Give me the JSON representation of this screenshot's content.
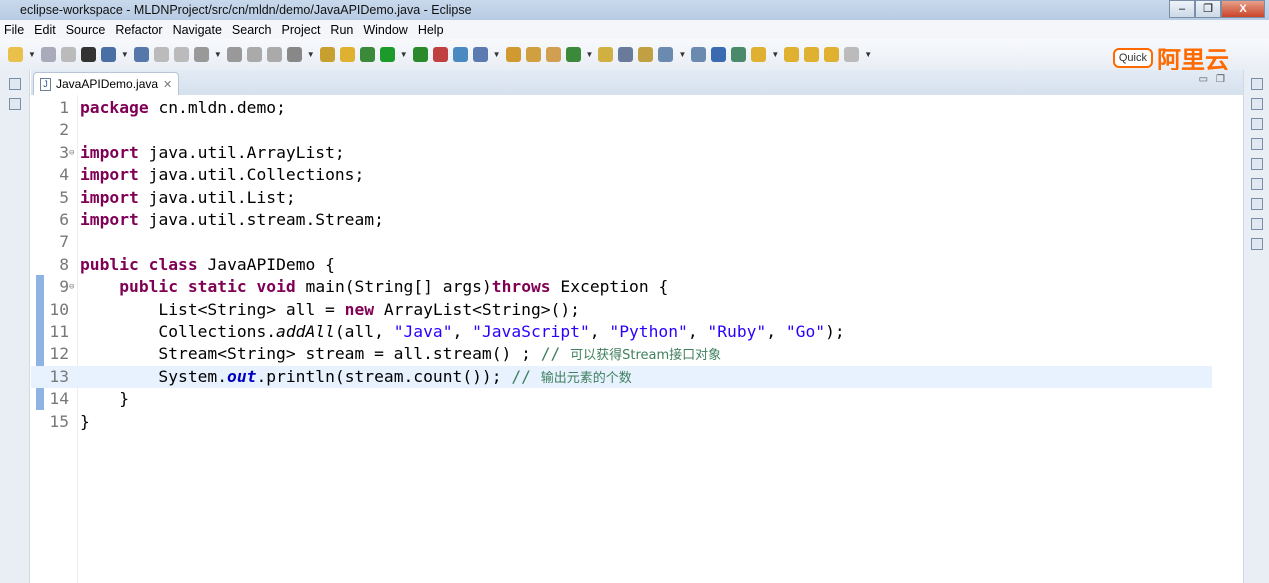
{
  "window": {
    "title": "eclipse-workspace - MLDNProject/src/cn/mldn/demo/JavaAPIDemo.java - Eclipse",
    "minimize": "–",
    "restore": "❐",
    "close": "X"
  },
  "menu": [
    "File",
    "Edit",
    "Source",
    "Refactor",
    "Navigate",
    "Search",
    "Project",
    "Run",
    "Window",
    "Help"
  ],
  "watermark": {
    "quick_access": "Quick",
    "brand": "阿里云"
  },
  "editor": {
    "tab": {
      "label": "JavaAPIDemo.java",
      "icon": "java-file-icon",
      "close": "✕"
    },
    "current_line": 13,
    "lines": [
      {
        "n": "1",
        "tokens": [
          [
            "k",
            "package"
          ],
          [
            "",
            "cn.mldn.demo;"
          ]
        ]
      },
      {
        "n": "2",
        "tokens": []
      },
      {
        "n": "3",
        "fold": "⊖",
        "tokens": [
          [
            "k",
            "import"
          ],
          [
            "",
            "java.util.ArrayList;"
          ]
        ]
      },
      {
        "n": "4",
        "tokens": [
          [
            "k",
            "import"
          ],
          [
            "",
            "java.util.Collections;"
          ]
        ]
      },
      {
        "n": "5",
        "tokens": [
          [
            "k",
            "import"
          ],
          [
            "",
            "java.util.List;"
          ]
        ]
      },
      {
        "n": "6",
        "tokens": [
          [
            "k",
            "import"
          ],
          [
            "",
            "java.util.stream.Stream;"
          ]
        ]
      },
      {
        "n": "7",
        "tokens": []
      },
      {
        "n": "8",
        "tokens": [
          [
            "k",
            "public"
          ],
          [
            "k",
            "class"
          ],
          [
            "",
            "JavaAPIDemo {"
          ]
        ]
      },
      {
        "n": "9",
        "fold": "⊖",
        "tokens": [
          [
            "",
            "    "
          ],
          [
            "k",
            "public"
          ],
          [
            "k",
            "static"
          ],
          [
            "k",
            "void"
          ],
          [
            "",
            "main(String[] args)"
          ],
          [
            "k",
            "throws"
          ],
          [
            "",
            "Exception {"
          ]
        ]
      },
      {
        "n": "10",
        "tokens": [
          [
            "",
            "        List<String> all = "
          ],
          [
            "k",
            "new"
          ],
          [
            "",
            "ArrayList<String>();"
          ]
        ]
      },
      {
        "n": "11",
        "tokens": [
          [
            "",
            "        Collections."
          ],
          [
            "i",
            "addAll"
          ],
          [
            "",
            "(all, "
          ],
          [
            "s",
            "\"Java\""
          ],
          [
            "",
            ", "
          ],
          [
            "s",
            "\"JavaScript\""
          ],
          [
            "",
            ", "
          ],
          [
            "s",
            "\"Python\""
          ],
          [
            "",
            ", "
          ],
          [
            "s",
            "\"Ruby\""
          ],
          [
            "",
            ", "
          ],
          [
            "s",
            "\"Go\""
          ],
          [
            "",
            ");"
          ]
        ]
      },
      {
        "n": "12",
        "tokens": [
          [
            "",
            "        Stream<String> stream = all.stream() ; "
          ],
          [
            "c",
            "// "
          ],
          [
            "cz",
            "可以获得Stream接口对象"
          ]
        ]
      },
      {
        "n": "13",
        "tokens": [
          [
            "",
            "        System."
          ],
          [
            "f",
            "out"
          ],
          [
            "",
            ".println(stream.count()); "
          ],
          [
            "c",
            "// "
          ],
          [
            "cz",
            "输出元素的个数"
          ]
        ]
      },
      {
        "n": "14",
        "tokens": [
          [
            "",
            "    }"
          ]
        ]
      },
      {
        "n": "15",
        "tokens": [
          [
            "",
            "}"
          ]
        ]
      }
    ]
  }
}
